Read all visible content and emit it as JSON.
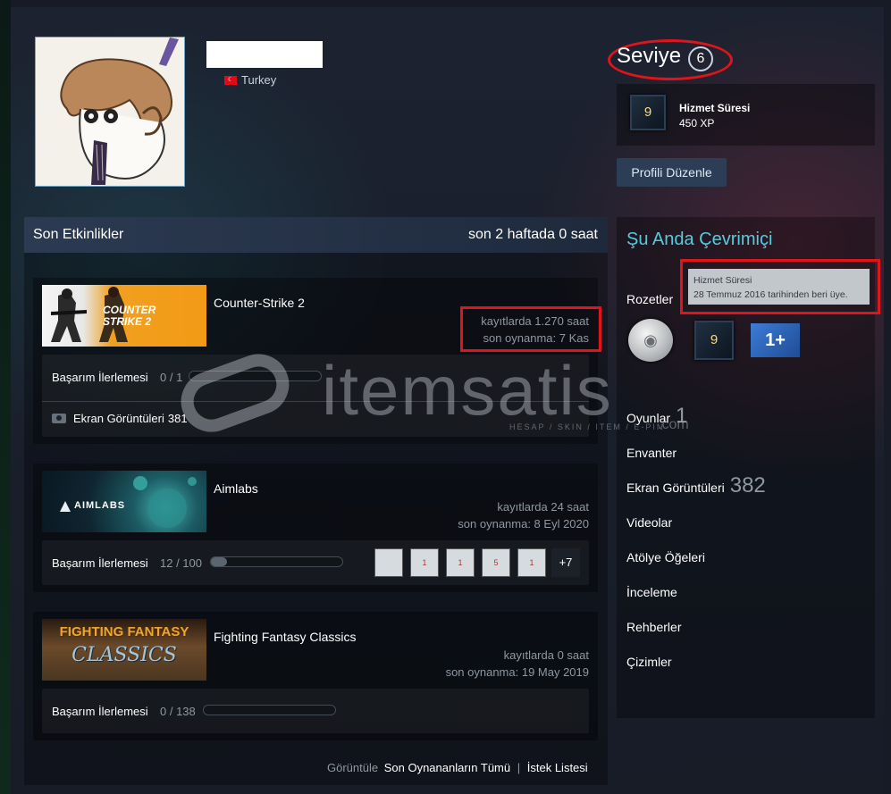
{
  "profile": {
    "country": "Turkey",
    "flag_icon": "turkey-flag-icon"
  },
  "level": {
    "label": "Seviye",
    "value": "6"
  },
  "badge": {
    "number": "9",
    "title": "Hizmet Süresi",
    "xp": "450 XP"
  },
  "edit_profile_label": "Profili Düzenle",
  "recent": {
    "title": "Son Etkinlikler",
    "hours_summary": "son 2 haftada 0 saat",
    "games": [
      {
        "name": "Counter-Strike 2",
        "capsule_text": [
          "COUNTER",
          "STRIKE 2"
        ],
        "hours": "kayıtlarda 1.270 saat",
        "last_played": "son oynanma: 7 Kas",
        "ach_label": "Başarım İlerlemesi",
        "ach_count": "0 / 1",
        "ach_progress": 0,
        "screenshots_label": "Ekran Görüntüleri",
        "screenshots_count": "381"
      },
      {
        "name": "Aimlabs",
        "capsule_text": "AIMLABS",
        "hours": "kayıtlarda 24 saat",
        "last_played": "son oynanma: 8 Eyl 2020",
        "ach_label": "Başarım İlerlemesi",
        "ach_count": "12 / 100",
        "ach_progress": 0.12,
        "ach_icon_numbers": [
          "",
          "1",
          "1",
          "5",
          "1"
        ],
        "more_achievements": "+7"
      },
      {
        "name": "Fighting Fantasy Classics",
        "capsule_text": [
          "FIGHTING FANTASY",
          "CLASSICS"
        ],
        "hours": "kayıtlarda 0 saat",
        "last_played": "son oynanma: 19 May 2019",
        "ach_label": "Başarım İlerlemesi",
        "ach_count": "0 / 138",
        "ach_progress": 0
      }
    ],
    "footer": {
      "view": "Görüntüle",
      "all_recent": "Son Oynananların Tümü",
      "separator": "|",
      "wishlist": "İstek Listesi"
    }
  },
  "right": {
    "online_status": "Şu Anda Çevrimiçi",
    "badges_label": "Rozetler",
    "tooltip": {
      "title": "Hizmet Süresi",
      "text": "28 Temmuz 2016 tarihinden beri üye."
    },
    "badge_numbers": [
      "9",
      "1+"
    ],
    "links": [
      {
        "label": "Oyunlar",
        "count": "1"
      },
      {
        "label": "Envanter",
        "count": ""
      },
      {
        "label": "Ekran Görüntüleri",
        "count": "382"
      },
      {
        "label": "Videolar",
        "count": ""
      },
      {
        "label": "Atölye Öğeleri",
        "count": ""
      },
      {
        "label": "İnceleme",
        "count": ""
      },
      {
        "label": "Rehberler",
        "count": ""
      },
      {
        "label": "Çizimler",
        "count": ""
      }
    ]
  },
  "watermark": {
    "brand": "itemsatis",
    "tagline": "HESAP / SKIN / ITEM / E-PIN",
    "suffix": ".com"
  },
  "colors": {
    "highlight_red": "#e0141b",
    "online_blue": "#57cbde",
    "button_bg": "#2b3e55"
  }
}
